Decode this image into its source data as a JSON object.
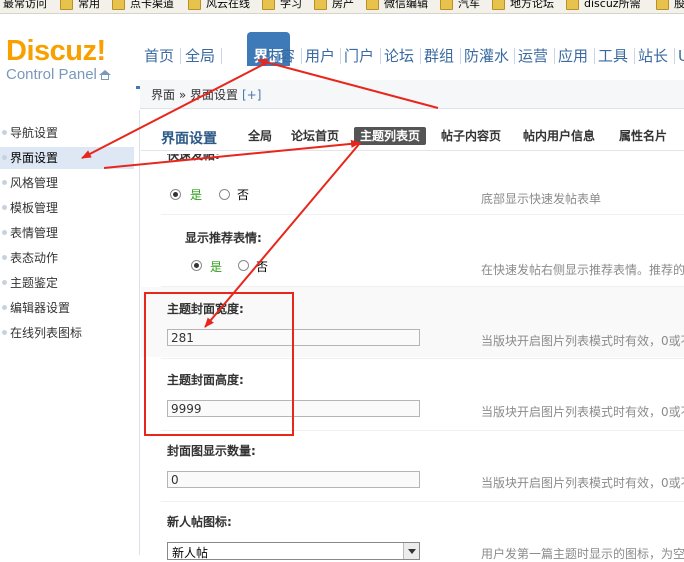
{
  "bookmarks": [
    "最常访问",
    "常用",
    "点卡渠道",
    "风云在线",
    "学习",
    "房产",
    "微信编辑",
    "汽车",
    "地方论坛",
    "discuz所需",
    "股"
  ],
  "logo": {
    "brand": "Discuz",
    "exclaim": "!",
    "subtitle": "Control Panel"
  },
  "topnav": [
    "首页",
    "全局",
    "界面",
    "内容",
    "用户",
    "门户",
    "论坛",
    "群组",
    "防灌水",
    "运营",
    "应用",
    "工具",
    "站长",
    "U"
  ],
  "topnav_active": "界面",
  "breadcrumb": {
    "path": "界面 » 界面设置",
    "add": "[+]"
  },
  "sidebar": {
    "items": [
      "导航设置",
      "界面设置",
      "风格管理",
      "模板管理",
      "表情管理",
      "表态动作",
      "主题鉴定",
      "编辑器设置",
      "在线列表图标"
    ],
    "active": "界面设置"
  },
  "main": {
    "title": "界面设置",
    "tabs": [
      "全局",
      "论坛首页",
      "主题列表页",
      "帖子内容页",
      "帖内用户信息",
      "属性名片"
    ],
    "active_tab": "主题列表页",
    "fields": {
      "quick_post": {
        "label": "快速发帖:",
        "yes": "是",
        "no": "否",
        "tip": "底部显示快速发帖表单"
      },
      "recommend_emoji": {
        "label": "显示推荐表情:",
        "yes": "是",
        "no": "否",
        "tip": "在快速发帖右侧显示推荐表情。推荐的"
      },
      "cover_width": {
        "label": "主题封面宽度:",
        "value": "281",
        "tip": "当版块开启图片列表模式时有效，0或不"
      },
      "cover_height": {
        "label": "主题封面高度:",
        "value": "9999",
        "tip": "当版块开启图片列表模式时有效，0或不"
      },
      "cover_count": {
        "label": "封面图显示数量:",
        "value": "0",
        "tip": "当版块开启图片列表模式时有效，0或不"
      },
      "new_post_icon": {
        "label": "新人帖图标:",
        "value": "新人帖",
        "tip": "用户发第一篇主题时显示的图标，为空"
      }
    }
  },
  "colors": {
    "accent": "#3e7ab8",
    "annotation": "#e8261b",
    "logo": "#f7a000"
  }
}
